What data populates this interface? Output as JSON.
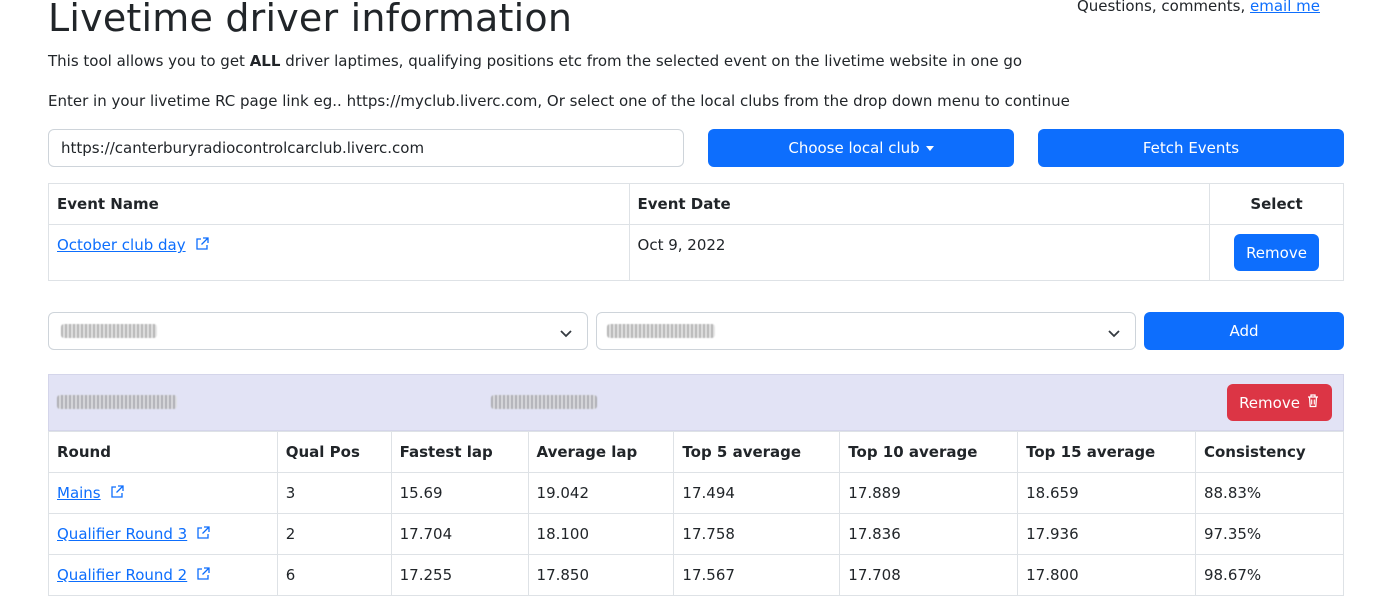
{
  "header": {
    "title": "Livetime driver information",
    "contact_text": "Questions, comments, ",
    "contact_link": "email me"
  },
  "intro": {
    "line1_pre": "This tool allows you to get ",
    "line1_bold": "ALL",
    "line1_post": " driver laptimes, qualifying positions etc from the selected event on the livetime website in one go",
    "line2": "Enter in your livetime RC page link eg.. https://myclub.liverc.com, Or select one of the local clubs from the drop down menu to continue"
  },
  "controls": {
    "url_value": "https://canterburyradiocontrolcarclub.liverc.com",
    "choose_label": "Choose local club",
    "fetch_label": "Fetch Events",
    "add_label": "Add"
  },
  "events": {
    "headers": [
      "Event Name",
      "Event Date",
      "Select"
    ],
    "rows": [
      {
        "name": "October club day",
        "date": "Oct 9, 2022",
        "action": "Remove"
      }
    ]
  },
  "driver_panel": {
    "remove_label": "Remove"
  },
  "results": {
    "headers": [
      "Round",
      "Qual Pos",
      "Fastest lap",
      "Average lap",
      "Top 5 average",
      "Top 10 average",
      "Top 15 average",
      "Consistency"
    ],
    "rows": [
      {
        "round": "Mains",
        "qual_pos": "3",
        "fastest": "15.69",
        "average": "19.042",
        "top5": "17.494",
        "top10": "17.889",
        "top15": "18.659",
        "consistency": "88.83%"
      },
      {
        "round": "Qualifier Round 3",
        "qual_pos": "2",
        "fastest": "17.704",
        "average": "18.100",
        "top5": "17.758",
        "top10": "17.836",
        "top15": "17.936",
        "consistency": "97.35%"
      },
      {
        "round": "Qualifier Round 2",
        "qual_pos": "6",
        "fastest": "17.255",
        "average": "17.850",
        "top5": "17.567",
        "top10": "17.708",
        "top15": "17.800",
        "consistency": "98.67%"
      }
    ]
  },
  "colors": {
    "primary": "#0d6efd",
    "danger": "#dc3545",
    "panel_bg": "#e2e3f5"
  },
  "icons": [
    "external-link-icon",
    "caret-down-icon",
    "chevron-down-icon",
    "trash-icon"
  ]
}
